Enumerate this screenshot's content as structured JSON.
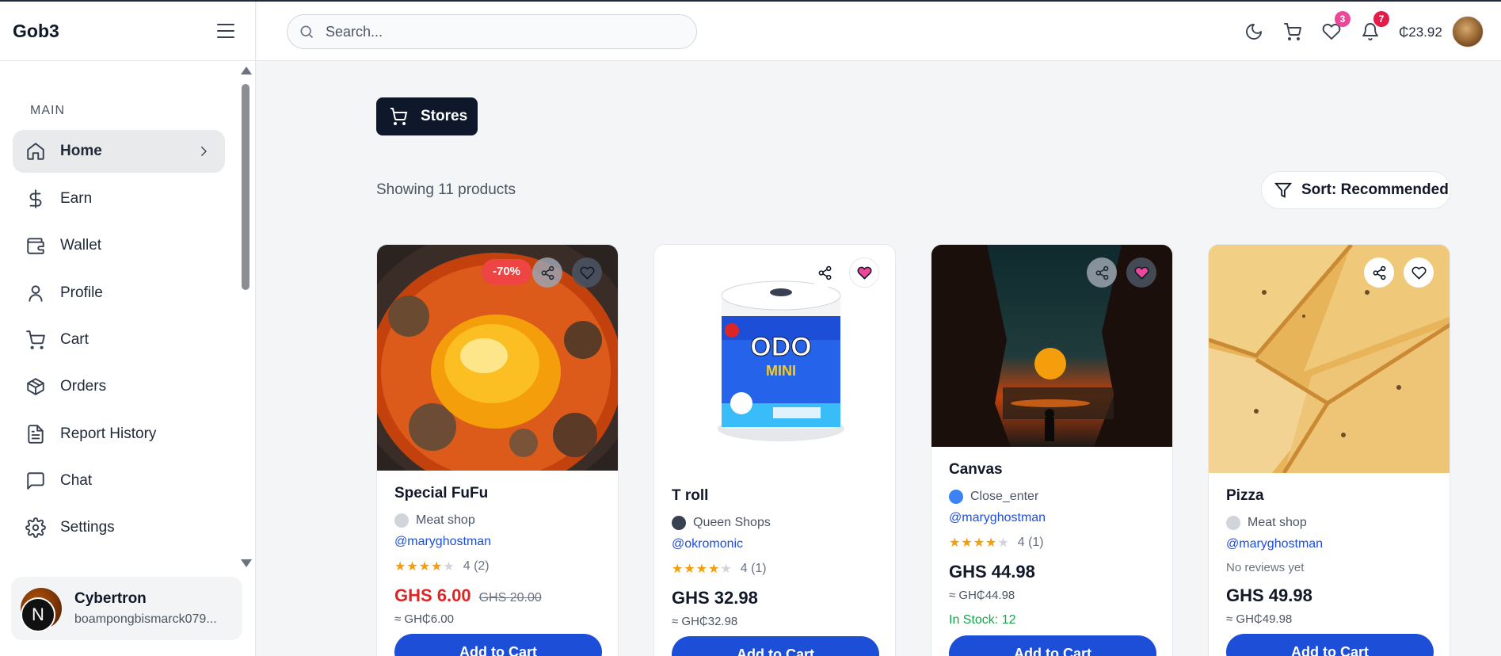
{
  "app": {
    "brand": "Gob3"
  },
  "header": {
    "search_placeholder": "Search...",
    "wishlist_count": "3",
    "notification_count": "7",
    "balance": "₵23.92"
  },
  "sidebar": {
    "section_label": "MAIN",
    "items": [
      {
        "label": "Home",
        "icon": "home-icon"
      },
      {
        "label": "Earn",
        "icon": "dollar-icon"
      },
      {
        "label": "Wallet",
        "icon": "wallet-icon"
      },
      {
        "label": "Profile",
        "icon": "user-icon"
      },
      {
        "label": "Cart",
        "icon": "cart-icon"
      },
      {
        "label": "Orders",
        "icon": "box-icon"
      },
      {
        "label": "Report History",
        "icon": "document-icon"
      },
      {
        "label": "Chat",
        "icon": "chat-icon"
      },
      {
        "label": "Settings",
        "icon": "gear-icon"
      }
    ],
    "user": {
      "name": "Cybertron",
      "email": "boampongbismarck079...",
      "badge_letter": "N"
    }
  },
  "main": {
    "stores_label": "Stores",
    "showing_text": "Showing 11 products",
    "sort_label": "Sort: Recommended"
  },
  "products": [
    {
      "name": "Special FuFu",
      "shop": "Meat shop",
      "handle": "@maryghostman",
      "rating_stars": 4,
      "rating_text": "4 (2)",
      "price": "GHS 6.00",
      "old_price": "GHS 20.00",
      "approx": "≈ GH₵6.00",
      "discount": "-70%",
      "add_label": "Add to Cart"
    },
    {
      "name": "T roll",
      "shop": "Queen Shops",
      "handle": "@okromonic",
      "rating_stars": 4,
      "rating_text": "4 (1)",
      "price": "GHS 32.98",
      "approx": "≈ GH₵32.98",
      "add_label": "Add to Cart",
      "product_label_top": "ODO",
      "product_label_bottom": "MINI"
    },
    {
      "name": "Canvas",
      "shop": "Close_enter",
      "handle": "@maryghostman",
      "rating_stars": 4,
      "rating_text": "4 (1)",
      "price": "GHS 44.98",
      "approx": "≈ GH₵44.98",
      "stock": "In Stock: 12",
      "add_label": "Add to Cart"
    },
    {
      "name": "Pizza",
      "shop": "Meat shop",
      "handle": "@maryghostman",
      "no_reviews": "No reviews yet",
      "price": "GHS 49.98",
      "approx": "≈ GH₵49.98",
      "add_label": "Add to Cart"
    }
  ],
  "colors": {
    "primary": "#1d4ed8",
    "dark": "#0f172a",
    "sale": "#dc2626",
    "pink": "#ec4899",
    "stock": "#16a34a"
  }
}
